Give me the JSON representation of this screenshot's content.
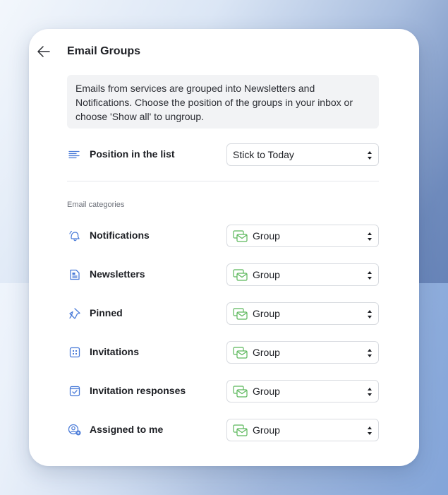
{
  "header": {
    "title": "Email Groups"
  },
  "info": {
    "text": "Emails from services are grouped into Newsletters and Notifications. Choose the position of the groups in your inbox or choose 'Show all' to ungroup."
  },
  "position": {
    "label": "Position in the list",
    "value": "Stick to Today"
  },
  "categories": {
    "section_label": "Email categories",
    "items": [
      {
        "label": "Notifications",
        "value": "Group",
        "icon": "bell-icon"
      },
      {
        "label": "Newsletters",
        "value": "Group",
        "icon": "newsletter-icon"
      },
      {
        "label": "Pinned",
        "value": "Group",
        "icon": "pin-icon"
      },
      {
        "label": "Invitations",
        "value": "Group",
        "icon": "calendar-icon"
      },
      {
        "label": "Invitation responses",
        "value": "Group",
        "icon": "calendar-check-icon"
      },
      {
        "label": "Assigned to me",
        "value": "Group",
        "icon": "user-assigned-icon"
      }
    ]
  },
  "colors": {
    "accent_blue": "#4a7bd8",
    "group_green": "#5bb75b"
  }
}
